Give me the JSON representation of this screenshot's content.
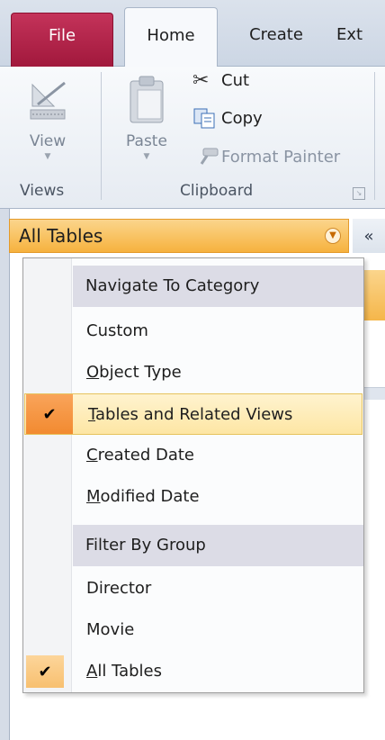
{
  "ribbon": {
    "tabs": {
      "file": "File",
      "home": "Home",
      "create": "Create",
      "external": "Ext"
    },
    "views_group": {
      "view_label": "View",
      "group_label": "Views"
    },
    "clipboard_group": {
      "paste_label": "Paste",
      "cut_label": "Cut",
      "copy_label": "Copy",
      "format_painter_label": "Format Painter",
      "group_label": "Clipboard"
    }
  },
  "nav": {
    "header_title": "All Tables",
    "collapse_glyph": "«"
  },
  "menu": {
    "items": [
      {
        "type": "header",
        "label": "Navigate To Category"
      },
      {
        "type": "option",
        "pre": "",
        "ul": "",
        "rest": "Custom",
        "checked": false
      },
      {
        "type": "option",
        "pre": "",
        "ul": "O",
        "rest": "bject Type",
        "checked": false
      },
      {
        "type": "option",
        "pre": "",
        "ul": "T",
        "rest": "ables and Related Views",
        "checked": true
      },
      {
        "type": "option",
        "pre": "",
        "ul": "C",
        "rest": "reated Date",
        "checked": false
      },
      {
        "type": "option",
        "pre": "",
        "ul": "M",
        "rest": "odified Date",
        "checked": false
      },
      {
        "type": "header",
        "label": "Filter By Group"
      },
      {
        "type": "option",
        "pre": "",
        "ul": "",
        "rest": "Director",
        "checked": false
      },
      {
        "type": "option",
        "pre": "",
        "ul": "",
        "rest": "Movie",
        "checked": false
      },
      {
        "type": "option",
        "pre": "",
        "ul": "A",
        "rest": "ll Tables",
        "checked": true
      }
    ],
    "check_glyph": "✔"
  },
  "colors": {
    "file_tab": "#b0224a",
    "nav_header": "#f6b23e",
    "selected_item": "#fde6a4",
    "check_bg": "#f28a30"
  }
}
